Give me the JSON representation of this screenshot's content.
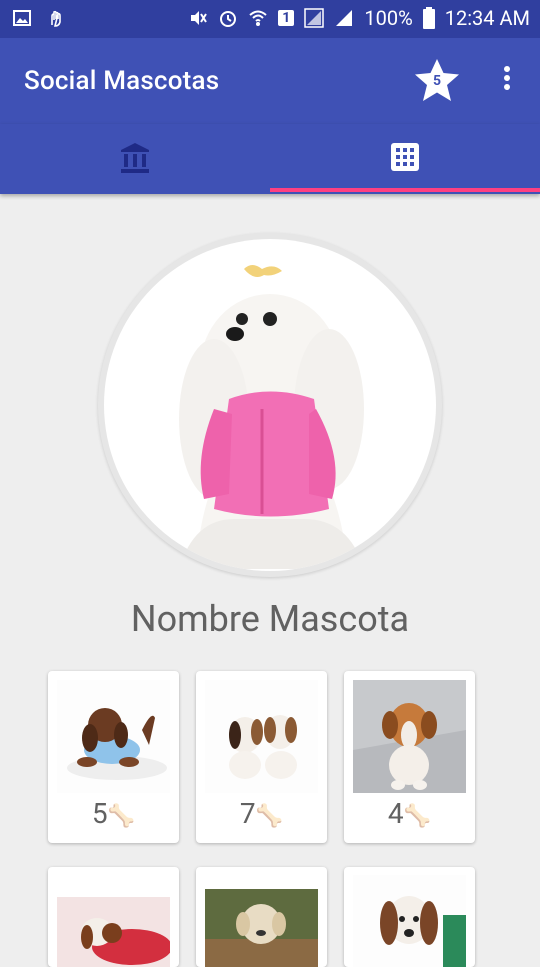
{
  "status_bar": {
    "battery": "100%",
    "time": "12:34 AM",
    "sim_slot": "1"
  },
  "app_bar": {
    "title": "Social Mascotas",
    "star_count": "5"
  },
  "tabs": [
    {
      "icon": "bank-icon",
      "selected": false
    },
    {
      "icon": "grid-icon",
      "selected": true
    }
  ],
  "profile": {
    "name": "Nombre Mascota"
  },
  "photos": [
    {
      "likes": "5",
      "icon": "bone-icon"
    },
    {
      "likes": "7",
      "icon": "bone-icon"
    },
    {
      "likes": "4",
      "icon": "bone-icon"
    },
    {
      "likes": "",
      "icon": "bone-icon"
    },
    {
      "likes": "",
      "icon": "bone-icon"
    },
    {
      "likes": "",
      "icon": "bone-icon"
    }
  ],
  "colors": {
    "primary": "#3f51b5",
    "primary_dark": "#303f9f",
    "accent": "#ff4081",
    "background": "#eeeeee"
  }
}
